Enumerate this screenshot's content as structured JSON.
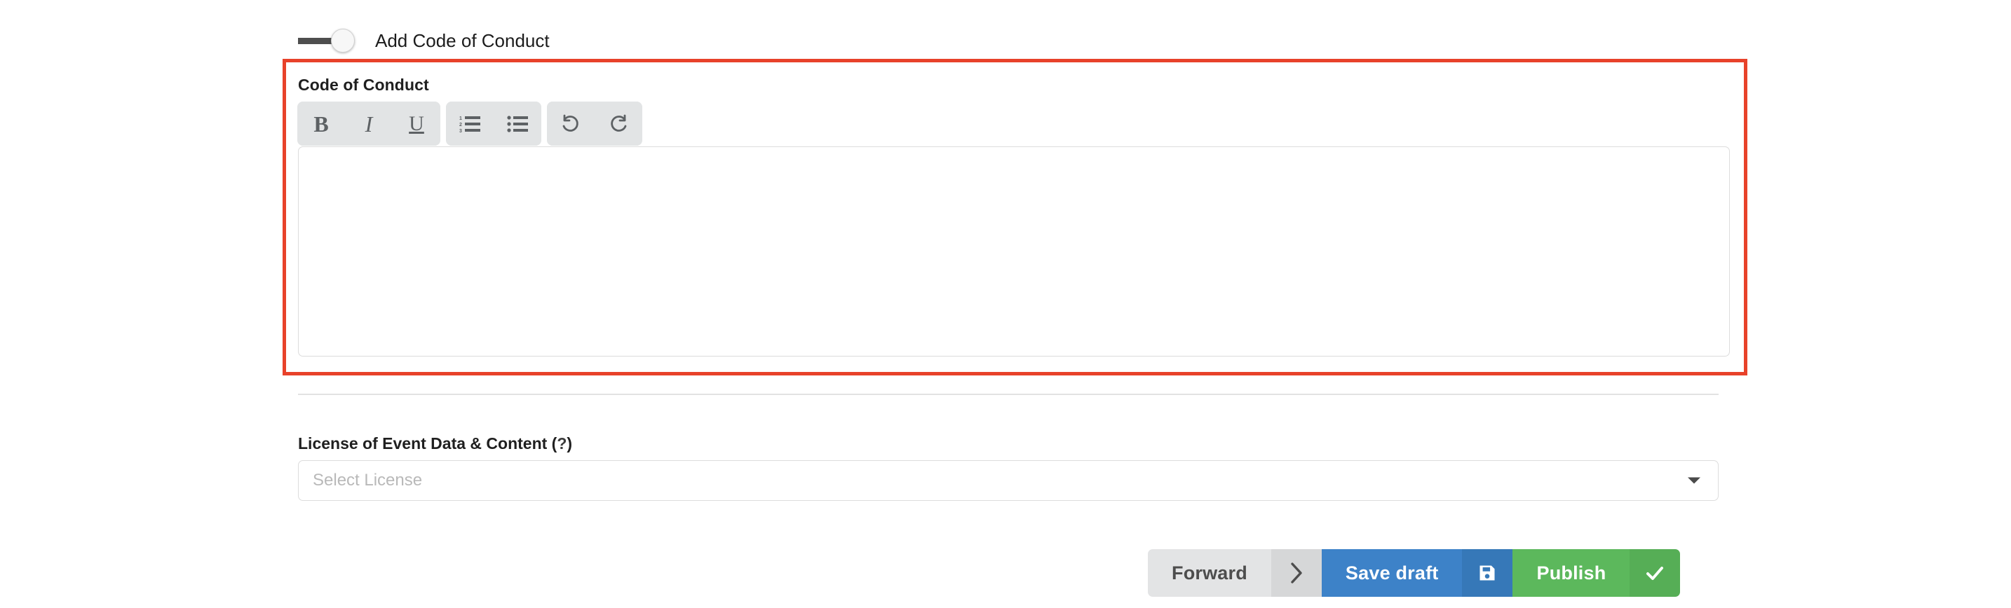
{
  "toggle": {
    "label": "Add Code of Conduct",
    "state": "on",
    "name": "add-code-of-conduct-toggle"
  },
  "code_of_conduct": {
    "label": "Code of Conduct",
    "editor": {
      "value": "",
      "placeholder": "",
      "toolbar_groups": [
        {
          "name": "text-format",
          "buttons": [
            {
              "name": "bold-icon",
              "label": "B"
            },
            {
              "name": "italic-icon",
              "label": "I"
            },
            {
              "name": "underline-icon",
              "label": "U"
            }
          ]
        },
        {
          "name": "lists",
          "buttons": [
            {
              "name": "ordered-list-icon",
              "label": ""
            },
            {
              "name": "unordered-list-icon",
              "label": ""
            }
          ]
        },
        {
          "name": "history",
          "buttons": [
            {
              "name": "undo-icon",
              "label": ""
            },
            {
              "name": "redo-icon",
              "label": ""
            }
          ]
        }
      ]
    },
    "highlight_color": "#e8422a"
  },
  "license": {
    "label_main": "License of Event Data & Content (",
    "label_help": "?",
    "label_close": ")",
    "select": {
      "placeholder": "Select License",
      "value": ""
    }
  },
  "actions": {
    "forward": {
      "label": "Forward",
      "icon": "chevron-right-icon",
      "color": "#e3e4e5"
    },
    "save_draft": {
      "label": "Save draft",
      "icon": "floppy-disk-icon",
      "color": "#3d82c8"
    },
    "publish": {
      "label": "Publish",
      "icon": "check-icon",
      "color": "#5cb85c"
    }
  }
}
